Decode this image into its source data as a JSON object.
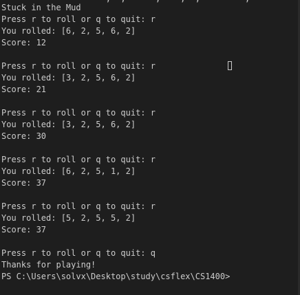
{
  "terminal": {
    "clipped_top_line": "                     ,  ,      ,    ,  ,         ,",
    "lines": [
      "Stuck in the Mud",
      "Press r to roll or q to quit: r",
      "You rolled: [6, 2, 5, 6, 2]",
      "Score: 12",
      "",
      "Press r to roll or q to quit: r",
      "You rolled: [3, 2, 5, 6, 2]",
      "Score: 21",
      "",
      "Press r to roll or q to quit: r",
      "You rolled: [3, 2, 5, 6, 2]",
      "Score: 30",
      "",
      "Press r to roll or q to quit: r",
      "You rolled: [6, 2, 5, 1, 2]",
      "Score: 37",
      "",
      "Press r to roll or q to quit: r",
      "You rolled: [5, 2, 5, 5, 2]",
      "Score: 37",
      "",
      "Press r to roll or q to quit: q",
      "Thanks for playing!",
      "PS C:\\Users\\solvx\\Desktop\\study\\csflex\\CS1400>"
    ],
    "colors": {
      "background": "#1e1e1e",
      "foreground": "#cccccc"
    }
  }
}
